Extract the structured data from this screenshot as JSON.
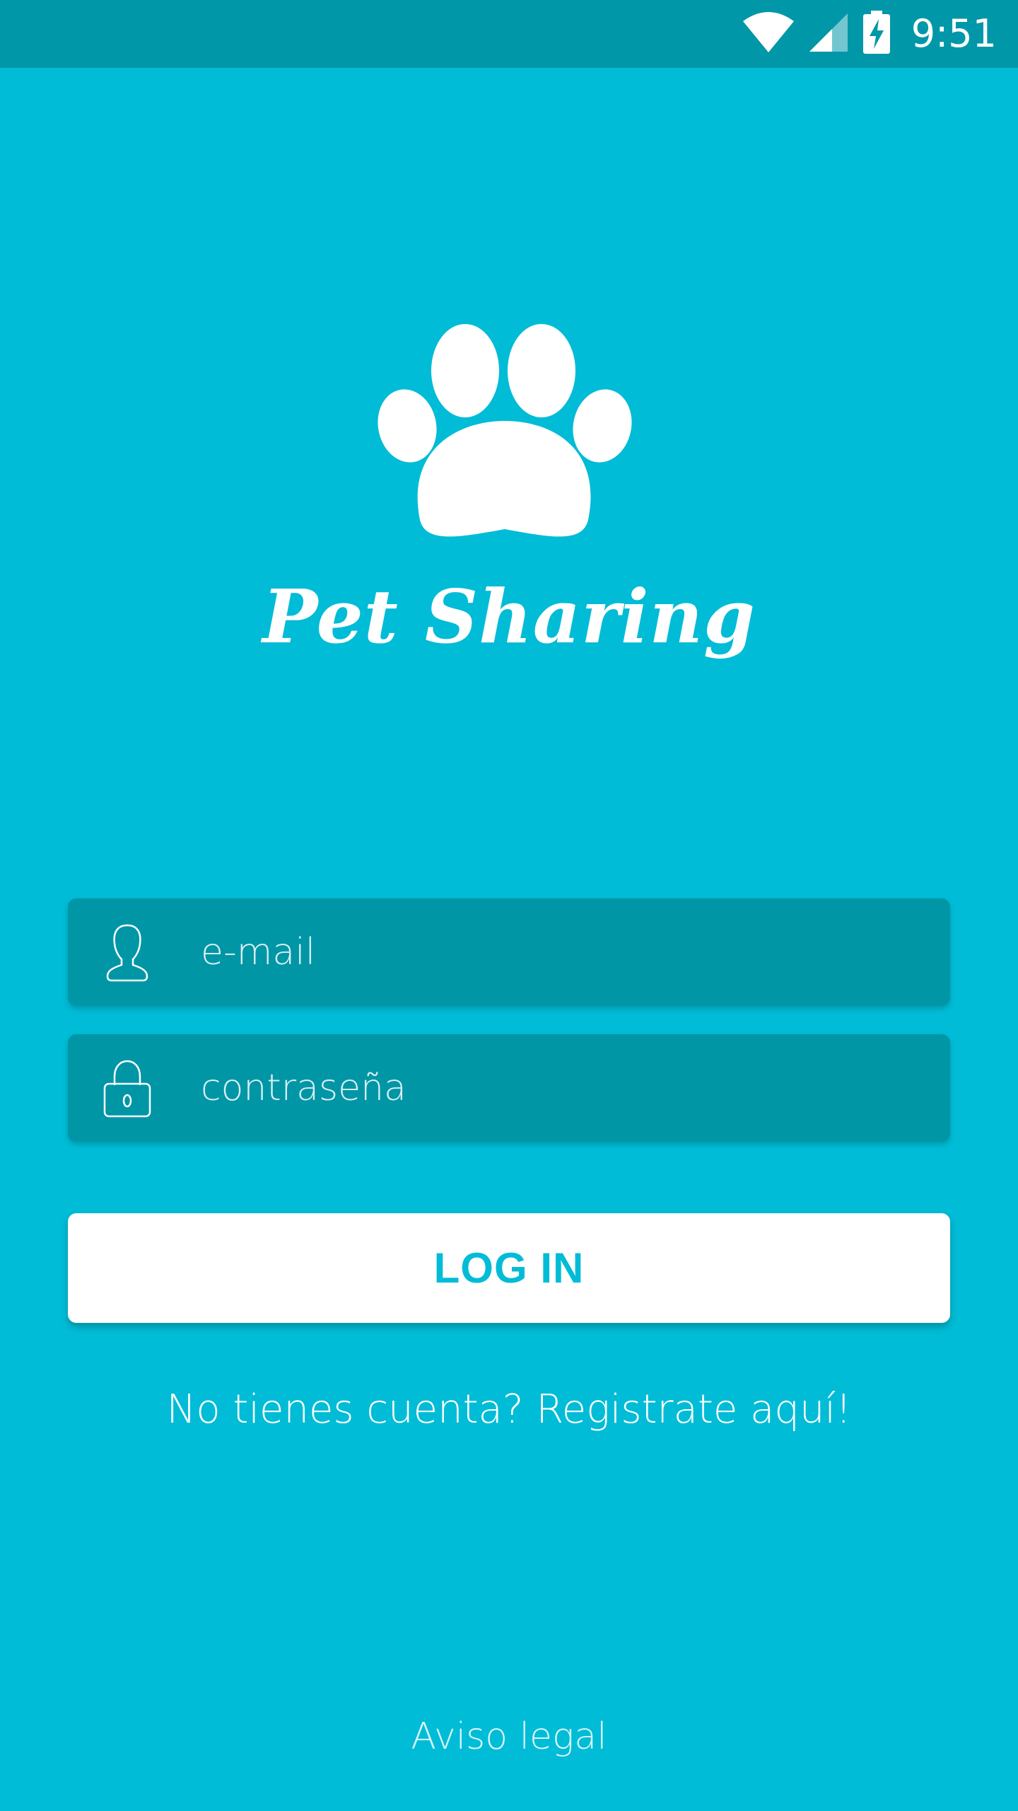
{
  "status_bar": {
    "time": "9:51",
    "icons": [
      "wifi-icon",
      "cell-signal-icon",
      "battery-charging-icon"
    ]
  },
  "brand": {
    "logo_icon": "paw-icon",
    "name": "Pet Sharing"
  },
  "login_form": {
    "email": {
      "icon": "user-icon",
      "placeholder": "e-mail",
      "value": ""
    },
    "password": {
      "icon": "lock-icon",
      "placeholder": "contraseña",
      "value": ""
    },
    "login_label": "LOG IN"
  },
  "register_link": "No tienes cuenta? Registrate aquí!",
  "legal_link": "Aviso legal",
  "colors": {
    "background": "#00BCD6",
    "status_bar": "#0097A8",
    "field_background": "#0096A6",
    "button_background": "#FFFFFF",
    "button_text": "#00BCD6"
  }
}
